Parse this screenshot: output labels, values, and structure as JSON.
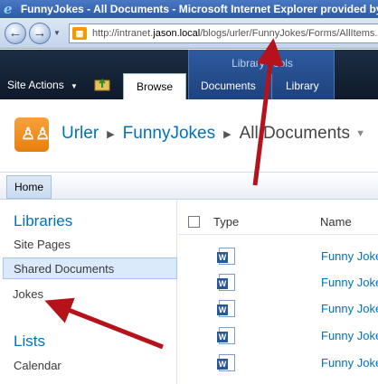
{
  "window": {
    "title": "FunnyJokes - All Documents - Microsoft Internet Explorer provided by"
  },
  "address_bar": {
    "url_prefix": "http://intranet.",
    "url_host": "jason.local",
    "url_path": "/blogs/urler/FunnyJokes/Forms/AllItems."
  },
  "ribbon": {
    "site_actions": "Site Actions",
    "tab_group_label": "Library Tools",
    "tabs": [
      {
        "label": "Browse"
      },
      {
        "label": "Documents"
      },
      {
        "label": "Library"
      }
    ]
  },
  "breadcrumb": {
    "items": [
      "Urler",
      "FunnyJokes",
      "All Documents"
    ]
  },
  "topbar": {
    "home": "Home"
  },
  "quick_launch": {
    "libraries_heading": "Libraries",
    "libraries": [
      "Site Pages",
      "Shared Documents",
      "Jokes"
    ],
    "lists_heading": "Lists",
    "lists": [
      "Calendar"
    ]
  },
  "list_view": {
    "columns": [
      "Type",
      "Name"
    ],
    "rows": [
      "Funny Joke",
      "Funny Joke",
      "Funny Joke",
      "Funny Joke",
      "Funny Joke"
    ]
  },
  "colors": {
    "annotation_arrow": "#b5121b",
    "link": "#0072bc",
    "ribbon": "#1c2d44"
  },
  "icons": [
    "ie-logo-icon",
    "back-icon",
    "forward-icon",
    "page-icon",
    "navigate-up-icon",
    "site-logo-icon",
    "word-doc-icon"
  ]
}
